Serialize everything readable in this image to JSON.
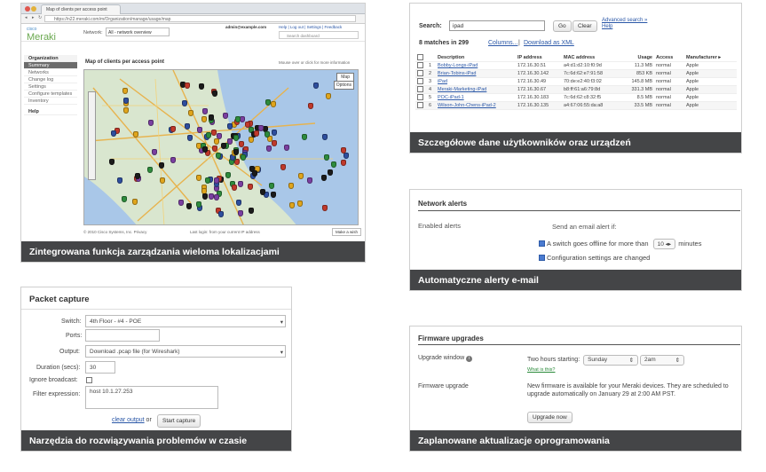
{
  "panel1": {
    "caption": "Zintegrowana funkcja zarządzania wieloma lokalizacjami",
    "browser_tab": "Map of clients per access point",
    "url": "https://n22.meraki.com/m/Organization/manage/usage/map",
    "brand": "Meraki",
    "brand_small": "cisco",
    "network_label": "Network:",
    "network_value": "All - network overview",
    "user": "admin@example.com",
    "top_links": "Help | Log out | Settings | Feedback",
    "search_placeholder": "Search dashboard",
    "sidebar": [
      "Organization",
      "Summary",
      "Networks",
      "Change log",
      "Settings",
      "Configure templates",
      "Inventory",
      "Help"
    ],
    "map_title": "Map of clients per access point",
    "map_hint": "Mouse over or click for more information",
    "map_btn": "Map",
    "options_btn": "Options",
    "footer_left": "© 2010 Cisco Systems, Inc.  Privacy",
    "footer_mid": "Last login: from your current IP address",
    "footer_right": "Make a wish"
  },
  "panel2": {
    "caption": "Szczegółowe dane użytkowników oraz urządzeń",
    "search_label": "Search:",
    "search_value": "ipad",
    "go": "Go",
    "clear": "Clear",
    "advanced": "Advanced search »",
    "help": "Help",
    "matches": "8 matches in 299",
    "columns": "Columns...",
    "download": "Download as XML",
    "headers": [
      "Description",
      "IP address",
      "MAC address",
      "Usage",
      "Access",
      "Manufacturer ▸"
    ],
    "rows": [
      [
        "1",
        "Bobby-Longs-iPad",
        "172.16.30.51",
        "a4:d1:d2:10:f0:9d",
        "11.3 MB",
        "normal",
        "Apple"
      ],
      [
        "2",
        "Brian-Tobins-iPad",
        "172.16.30.142",
        "7c:6d:62:e7:91:58",
        "853 KB",
        "normal",
        "Apple"
      ],
      [
        "3",
        "iPad",
        "172.16.30.49",
        "70:de:e2:40:f3:02",
        "145.8 MB",
        "normal",
        "Apple"
      ],
      [
        "4",
        "Meraki-Marketing-iPad",
        "172.16.30.67",
        "b8:ff:61:a6:79:8d",
        "331.3 MB",
        "normal",
        "Apple"
      ],
      [
        "5",
        "POC-iPad-1",
        "172.16.30.183",
        "7c:6d:62:c8:32:f5",
        "8.5 MB",
        "normal",
        "Apple"
      ],
      [
        "6",
        "Wilson-John-Chens-iPad-2",
        "172.16.30.135",
        "a4:67:06:55:da:a8",
        "33.5 MB",
        "normal",
        "Apple"
      ]
    ]
  },
  "panel3": {
    "caption": "Automatyczne alerty e-mail",
    "title": "Network alerts",
    "label": "Enabled alerts",
    "send": "Send an email alert if:",
    "alert1_pre": "A switch goes offline for more than",
    "alert1_value": "10",
    "alert1_post": "minutes",
    "alert2": "Configuration settings are changed"
  },
  "panel4": {
    "caption": "Narzędzia do rozwiązywania problemów w czasie",
    "title": "Packet capture",
    "switch_label": "Switch:",
    "switch_value": "4th Floor - #4 - POE",
    "ports_label": "Ports:",
    "ports_value": "",
    "output_label": "Output:",
    "output_value": "Download .pcap file (for Wireshark)",
    "duration_label": "Duration (secs):",
    "duration_value": "30",
    "ignore_label": "Ignore broadcast:",
    "filter_label": "Filter expression:",
    "filter_value": "host 10.1.27.253",
    "clear_output": "clear output",
    "or": "or",
    "start": "Start capture"
  },
  "panel5": {
    "caption": "Zaplanowane aktualizacje oprogramowania",
    "title": "Firmware upgrades",
    "window_label": "Upgrade window",
    "window_text": "Two hours starting:",
    "day": "Sunday",
    "time": "2am",
    "what": "What is this?",
    "fw_label": "Firmware upgrade",
    "fw_text": "New firmware is available for your Meraki devices. They are scheduled to upgrade automatically on January 29 at 2:00 AM PST.",
    "upgrade_btn": "Upgrade now"
  }
}
